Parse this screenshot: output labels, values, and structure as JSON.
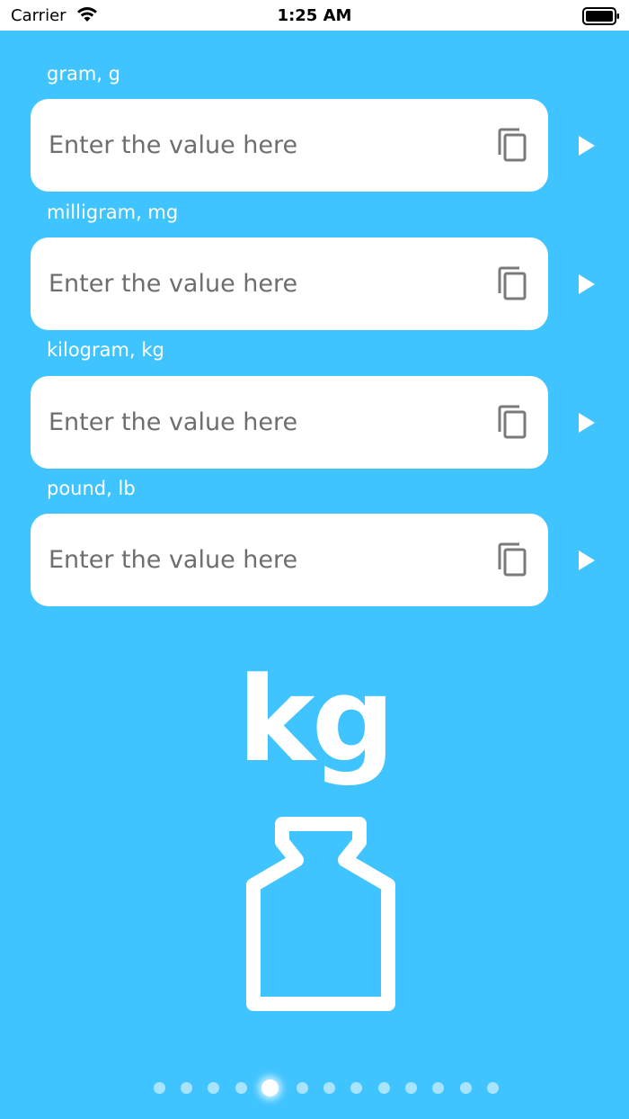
{
  "status_bar": {
    "carrier": "Carrier",
    "time": "1:25 AM"
  },
  "converter": {
    "fields": [
      {
        "label": "gram, g",
        "placeholder": "Enter the value here",
        "value": ""
      },
      {
        "label": "milligram, mg",
        "placeholder": "Enter the value here",
        "value": ""
      },
      {
        "label": "kilogram, kg",
        "placeholder": "Enter the value here",
        "value": ""
      },
      {
        "label": "pound, lb",
        "placeholder": "Enter the value here",
        "value": ""
      }
    ]
  },
  "hero": {
    "logo_text": "kg",
    "icon": "weight-icon"
  },
  "pager": {
    "count": 13,
    "active_index": 4
  },
  "colors": {
    "background": "#40C4FF",
    "field": "#FFFFFF",
    "accent": "#FFFFFF"
  }
}
